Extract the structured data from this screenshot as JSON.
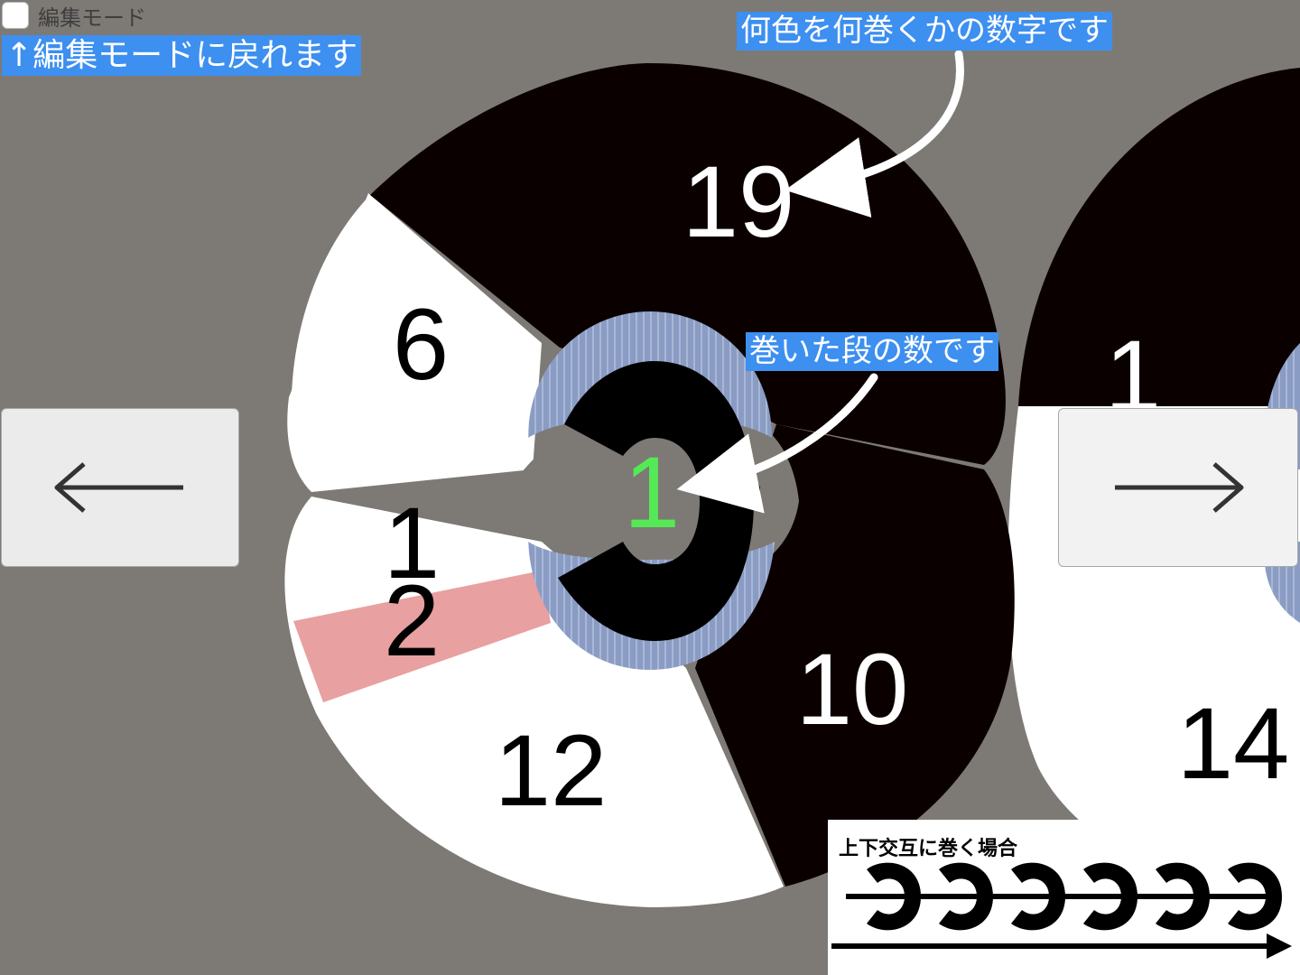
{
  "edit_mode": {
    "checkbox_label": "編集モード",
    "checked": false
  },
  "annotations": {
    "edit_hint": "↑編集モードに戻れます",
    "color_hint": "何色を何巻くかの数字です",
    "layer_hint": "巻いた段の数です"
  },
  "navigation": {
    "prev_symbol": "←",
    "next_symbol": "→"
  },
  "layer_count": "1",
  "wheel_segments": [
    {
      "value": "19",
      "color": "#0a0000"
    },
    {
      "value": "6",
      "color": "#ffffff"
    },
    {
      "value": "1",
      "color": "#ffffff"
    },
    {
      "value": "2",
      "color": "#e8a0a0"
    },
    {
      "value": "12",
      "color": "#ffffff"
    },
    {
      "value": "10",
      "color": "#0a0000"
    }
  ],
  "next_wheel_segments": [
    {
      "value": "1",
      "color": "#0a0000"
    },
    {
      "value": "14",
      "color": "#ffffff"
    }
  ],
  "legend": {
    "title": "上下交互に巻く場合"
  },
  "colors": {
    "background": "#7d7a75",
    "annotation_bg": "#3d8ff0",
    "layer_count_color": "#55ea55",
    "hub_color": "#8a9cc4",
    "black_segment": "#0a0000",
    "pink_segment": "#e8a0a0"
  },
  "icons": {
    "prev": "left-arrow-icon",
    "next": "right-arrow-icon",
    "annotation_arrows": "curved-arrow-icon"
  }
}
